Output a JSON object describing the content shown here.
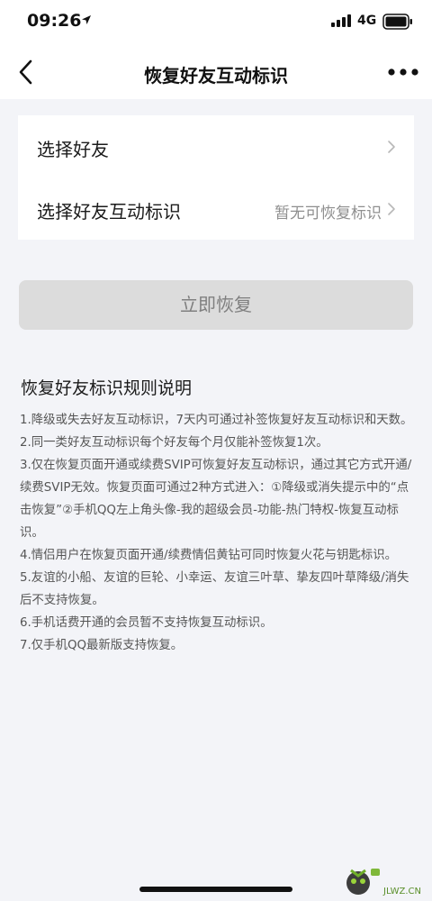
{
  "status_bar": {
    "time": "09:26",
    "network": "4G",
    "icons": [
      "location-arrow-icon",
      "signal-bars-icon",
      "battery-icon"
    ]
  },
  "nav": {
    "title": "恢复好友互动标识",
    "back_icon": "chevron-left-icon",
    "more_icon": "more-dots-icon"
  },
  "settings": {
    "rows": [
      {
        "label": "选择好友",
        "value": ""
      },
      {
        "label": "选择好友互动标识",
        "value": "暂无可恢复标识"
      }
    ]
  },
  "restore_button": {
    "label": "立即恢复",
    "enabled": false
  },
  "rules": {
    "title": "恢复好友标识规则说明",
    "items": [
      "1.降级或失去好友互动标识，7天内可通过补签恢复好友互动标识和天数。",
      "2.同一类好友互动标识每个好友每个月仅能补签恢复1次。",
      "3.仅在恢复页面开通或续费SVIP可恢复好友互动标识，通过其它方式开通/续费SVIP无效。恢复页面可通过2种方式进入：①降级或消失提示中的“点击恢复”②手机QQ左上角头像-我的超级会员-功能-热门特权-恢复互动标识。",
      "4.情侣用户在恢复页面开通/续费情侣黄钻可同时恢复火花与钥匙标识。",
      "5.友谊的小船、友谊的巨轮、小幸运、友谊三叶草、挚友四叶草降级/消失后不支持恢复。",
      "6.手机话费开通的会员暂不支持恢复互动标识。",
      "7.仅手机QQ最新版支持恢复。"
    ]
  },
  "watermark": {
    "text": "JLWZ.CN"
  },
  "colors": {
    "page_bg": "#f3f4f8",
    "button_disabled_bg": "#dcdcdc",
    "button_disabled_text": "#7f7f7f",
    "secondary_text": "#8f8f8f"
  }
}
